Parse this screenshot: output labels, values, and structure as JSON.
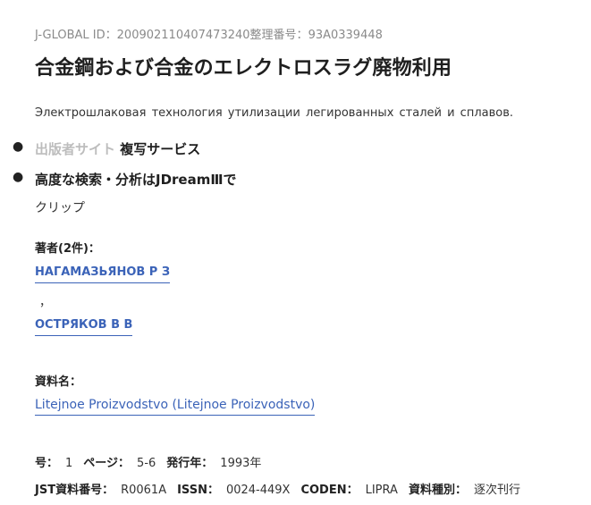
{
  "header": {
    "jglobal_label": "J-GLOBAL ID：",
    "jglobal_id": "200902110407473240",
    "seiri_label": "整理番号：",
    "seiri_no": "93A0339448"
  },
  "title": "合金鋼および合金のエレクトロスラグ廃物利用",
  "subtitle": "Электрошлаковая технология утилизации легированных сталей и сплавов.",
  "links": {
    "publisher_site": "出版者サイト",
    "copy_service": "複写サービス",
    "jdream": "高度な検索・分析はJDreamⅢで",
    "clip": "クリップ"
  },
  "authors": {
    "label": "著者(2件)：",
    "names": [
      "НАГАМАЗЬЯНОВ Р З",
      "ОСТРЯКОВ В В"
    ],
    "separator": "，"
  },
  "source": {
    "label": "資料名：",
    "name": "Litejnoe Proizvodstvo (Litejnoe Proizvodstvo)"
  },
  "meta": {
    "issue_label": "号：",
    "issue": "1",
    "page_label": "ページ：",
    "pages": "5-6",
    "year_label": "発行年：",
    "year": "1993年",
    "jst_label": "JST資料番号：",
    "jst": "R0061A",
    "issn_label": "ISSN：",
    "issn": "0024-449X",
    "coden_label": "CODEN：",
    "coden": "LIPRA",
    "type_label": "資料種別：",
    "type": "逐次刊行"
  }
}
